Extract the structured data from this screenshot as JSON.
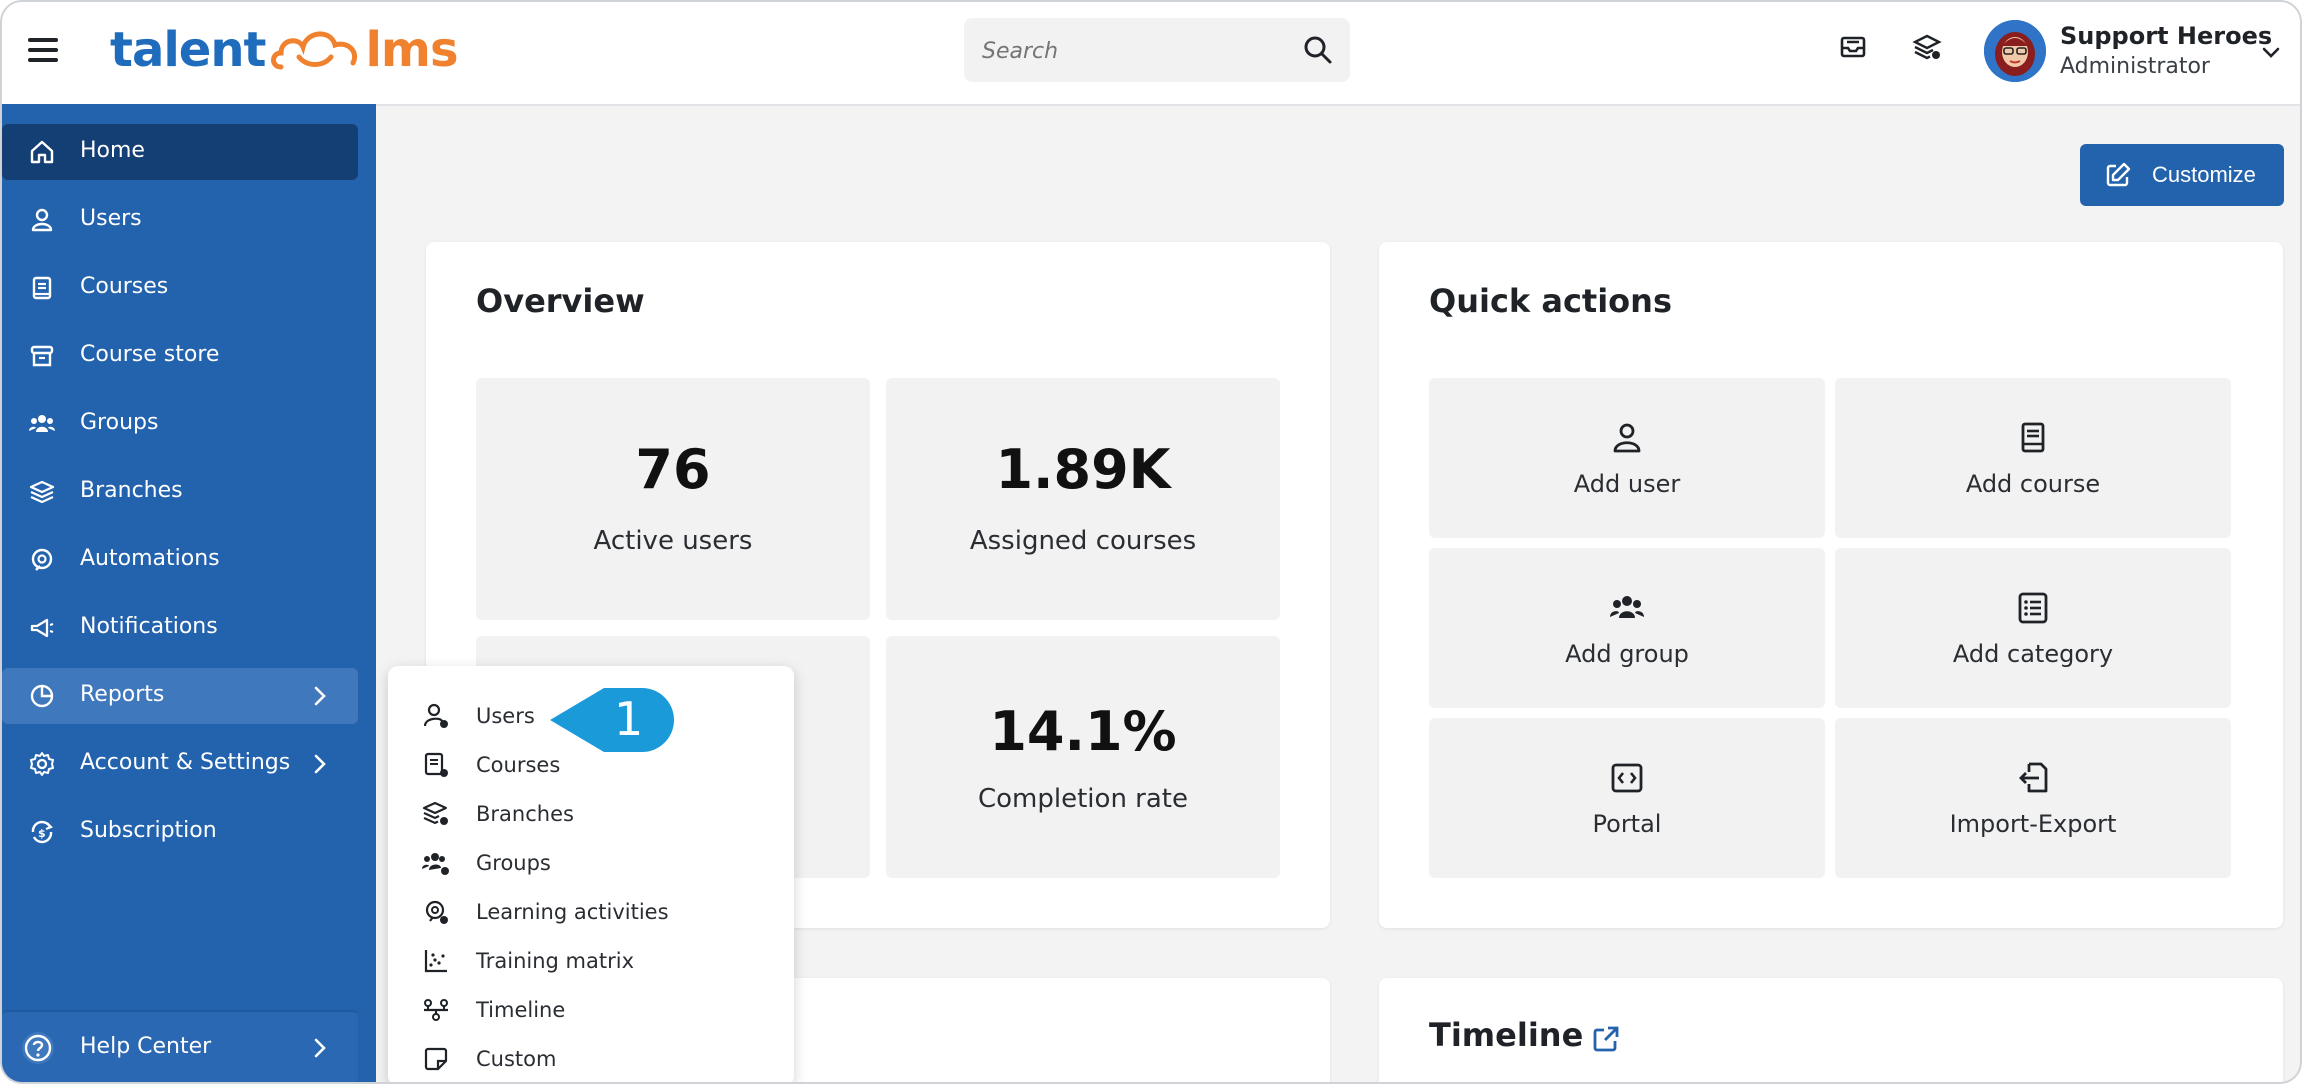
{
  "header": {
    "logo_part1": "talent",
    "logo_part2": "lms",
    "search_placeholder": "Search",
    "user_name": "Support Heroes",
    "user_role": "Administrator"
  },
  "sidebar": {
    "items": [
      {
        "label": "Home",
        "icon": "home-icon"
      },
      {
        "label": "Users",
        "icon": "user-icon"
      },
      {
        "label": "Courses",
        "icon": "book-icon"
      },
      {
        "label": "Course store",
        "icon": "store-icon"
      },
      {
        "label": "Groups",
        "icon": "group-icon"
      },
      {
        "label": "Branches",
        "icon": "layers-icon"
      },
      {
        "label": "Automations",
        "icon": "automation-icon"
      },
      {
        "label": "Notifications",
        "icon": "megaphone-icon"
      },
      {
        "label": "Reports",
        "icon": "pie-chart-icon"
      },
      {
        "label": "Account & Settings",
        "icon": "gear-icon"
      },
      {
        "label": "Subscription",
        "icon": "subscription-icon"
      }
    ],
    "help_label": "Help Center"
  },
  "main": {
    "customize_label": "Customize",
    "overview": {
      "title": "Overview",
      "stats": [
        {
          "value": "76",
          "label": "Active users"
        },
        {
          "value": "1.89K",
          "label": "Assigned courses"
        },
        {
          "value": "14.1%",
          "label": "Completion rate"
        }
      ]
    },
    "quick_actions": {
      "title": "Quick actions",
      "items": [
        {
          "label": "Add user",
          "icon": "user-icon"
        },
        {
          "label": "Add course",
          "icon": "book-icon"
        },
        {
          "label": "Add group",
          "icon": "group-icon"
        },
        {
          "label": "Add category",
          "icon": "list-icon"
        },
        {
          "label": "Portal",
          "icon": "code-icon"
        },
        {
          "label": "Import-Export",
          "icon": "import-export-icon"
        }
      ]
    },
    "timeline": {
      "title": "Timeline"
    }
  },
  "reports_menu": {
    "items": [
      {
        "label": "Users",
        "icon": "user-report-icon"
      },
      {
        "label": "Courses",
        "icon": "course-report-icon"
      },
      {
        "label": "Branches",
        "icon": "branch-report-icon"
      },
      {
        "label": "Groups",
        "icon": "group-report-icon"
      },
      {
        "label": "Learning activities",
        "icon": "learning-activities-icon"
      },
      {
        "label": "Training matrix",
        "icon": "training-matrix-icon"
      },
      {
        "label": "Timeline",
        "icon": "timeline-icon"
      },
      {
        "label": "Custom",
        "icon": "custom-report-icon"
      }
    ]
  },
  "callout": {
    "number": "1"
  },
  "colors": {
    "sidebar_bg": "#2362ad",
    "sidebar_active": "#143f75",
    "accent_orange": "#f0812f",
    "callout_blue": "#1b9ad9"
  }
}
